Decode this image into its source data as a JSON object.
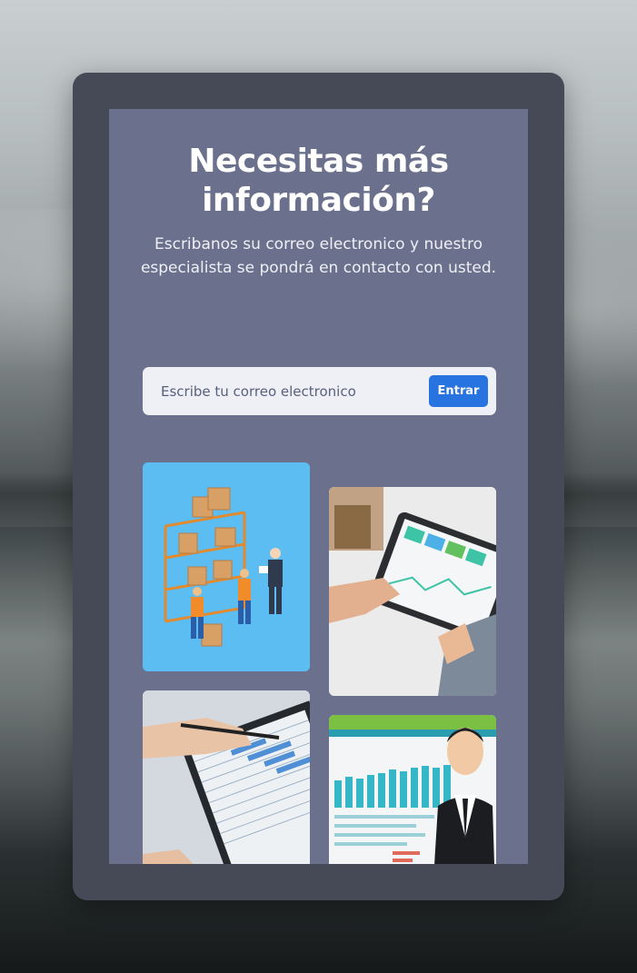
{
  "cta": {
    "title": "Necesitas más información?",
    "subtitle": "Escribanos su correo electronico y nuestro especialista se pondrá en contacto con usted."
  },
  "form": {
    "email_placeholder": "Escribe tu correo electronico",
    "email_value": "",
    "submit_label": "Entrar"
  },
  "colors": {
    "panel": "#6b718c",
    "frame": "#464a56",
    "accent_button": "#2774e0",
    "input_background": "#eff0f6"
  },
  "gallery": [
    {
      "icon": "warehouse-workers-illustration"
    },
    {
      "icon": "tablet-dashboard-photo"
    },
    {
      "icon": "laptop-gantt-chart-photo"
    },
    {
      "icon": "businessman-analytics-illustration"
    }
  ]
}
